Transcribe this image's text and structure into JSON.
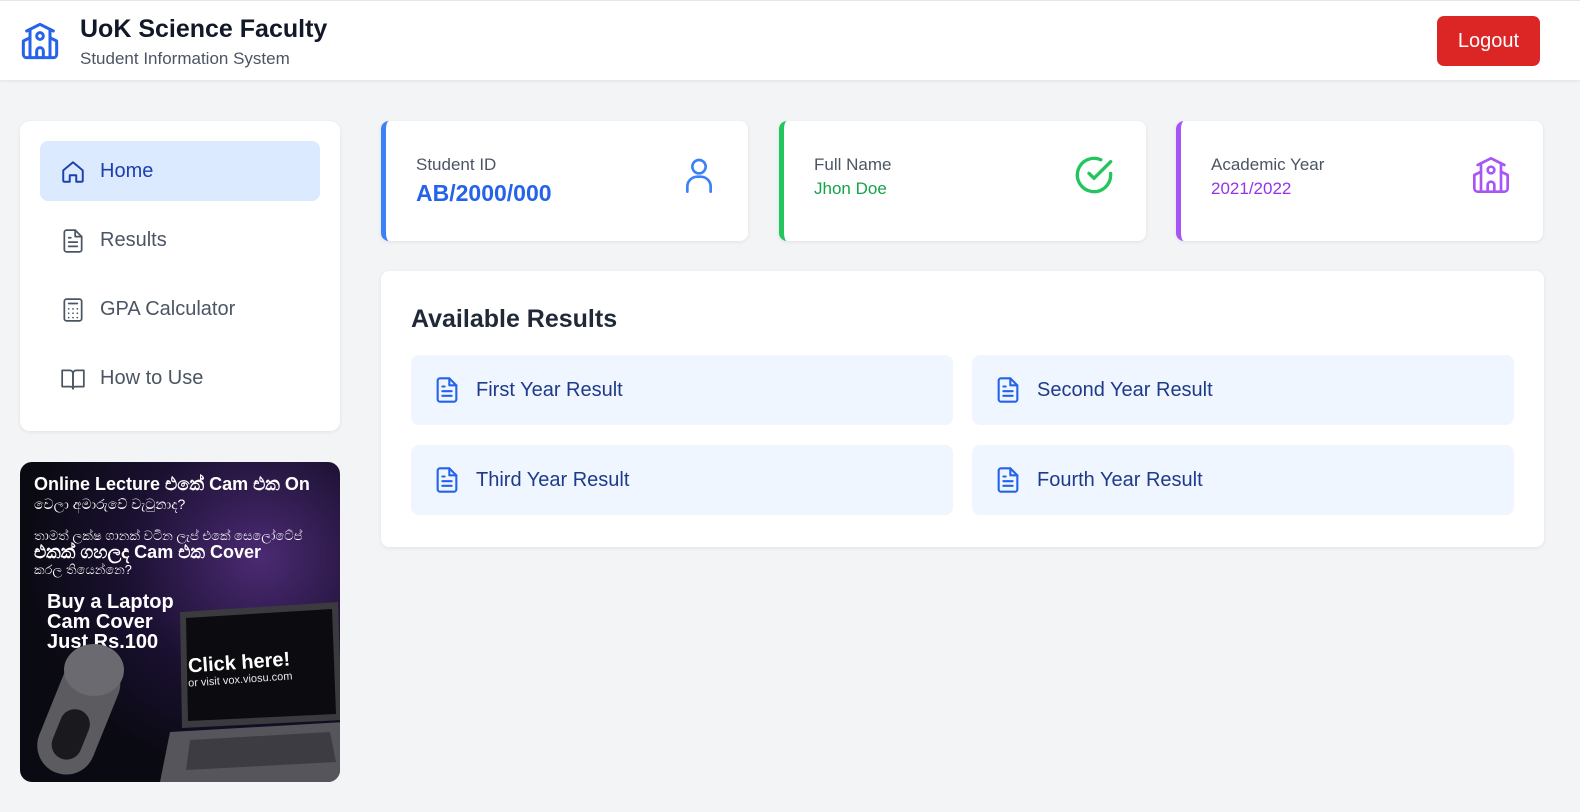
{
  "header": {
    "title": "UoK Science Faculty",
    "subtitle": "Student Information System",
    "logout_label": "Logout"
  },
  "sidebar": {
    "items": [
      {
        "label": "Home",
        "icon": "home-icon",
        "active": true
      },
      {
        "label": "Results",
        "icon": "document-icon",
        "active": false
      },
      {
        "label": "GPA Calculator",
        "icon": "calculator-icon",
        "active": false
      },
      {
        "label": "How to Use",
        "icon": "book-open-icon",
        "active": false
      }
    ]
  },
  "ad": {
    "line1": "Online Lecture එකේ Cam එක On",
    "line2": "වෙලා අමාරුවේ වැටුනාද?",
    "line3": "තාමත් ලක්ෂ ගානක් වටින ලැප් එකේ සෙලෝටේප්",
    "line4": "එකක් ගහලද Cam එක Cover",
    "line5": "කරල තියෙන්නෙ?",
    "buy_line1": "Buy a Laptop",
    "buy_line2": "Cam Cover",
    "buy_line3": "Just Rs.100",
    "cta": "Click here!",
    "visit": "or visit vox.viosu.com"
  },
  "cards": {
    "student_id": {
      "label": "Student ID",
      "value": "AB/2000/000",
      "icon": "user-icon"
    },
    "full_name": {
      "label": "Full Name",
      "value": "Jhon Doe",
      "icon": "check-circle-icon"
    },
    "academic_year": {
      "label": "Academic Year",
      "value": "2021/2022",
      "icon": "building-icon"
    }
  },
  "results": {
    "title": "Available Results",
    "items": [
      {
        "label": "First Year Result"
      },
      {
        "label": "Second Year Result"
      },
      {
        "label": "Third Year Result"
      },
      {
        "label": "Fourth Year Result"
      }
    ]
  },
  "colors": {
    "accent_blue": "#2563eb",
    "accent_green": "#16a34a",
    "accent_purple": "#9333ea",
    "logout_red": "#dc2626",
    "active_nav_bg": "#dbeafe",
    "result_btn_bg": "#eff6ff"
  }
}
